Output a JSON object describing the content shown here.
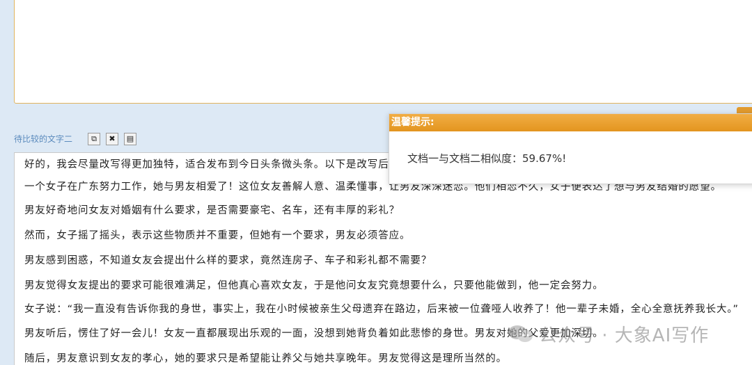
{
  "compare_field_label": "待比较的文字二",
  "toolbar": [
    {
      "name": "copy-icon",
      "glyph": "⧉"
    },
    {
      "name": "clear-icon",
      "glyph": "✖"
    },
    {
      "name": "comment-icon",
      "glyph": "▤"
    }
  ],
  "text_lines": [
    "好的，我会尽量改写得更加独特，适合发布到今日头条微头条。以下是改写后的内容：",
    "一个女子在广东努力工作，她与男友相爱了！这位女友善解人意、温柔懂事，让男友深深迷恋。他们相恋不久，女子便表达了想与男友结婚的愿望。",
    "男友好奇地问女友对婚姻有什么要求，是否需要豪宅、名车，还有丰厚的彩礼？",
    "然而，女子摇了摇头，表示这些物质并不重要，但她有一个要求，男友必须答应。",
    "男友感到困惑，不知道女友会提出什么样的要求，竟然连房子、车子和彩礼都不需要？",
    "男友觉得女友提出的要求可能很难满足，但他真心喜欢女友，于是他问女友究竟想要什么，只要他能做到，他一定会努力。",
    "女子说：“我一直没有告诉你我的身世，事实上，我在小时候被亲生父母遗弃在路边，后来被一位聋哑人收养了！他一辈子未婚，全心全意抚养我长大。”",
    "男友听后，愣住了好一会儿！女友一直都展现出乐观的一面，没想到她背负着如此悲惨的身世。男友对她的父爱更加深切。",
    "随后，男友意识到女友的孝心，她的要求只是希望能让养父与她共享晚年。男友觉得这是理所当然的。"
  ],
  "dialog": {
    "title": "温馨提示:",
    "message": "文档一与文档二相似度：59.67%!"
  },
  "watermark": {
    "text": "公众号 · 大象AI写作",
    "icon": "wechat-icon"
  },
  "colors": {
    "accent_orange": "#e3951f",
    "label_blue": "#5b8bbd",
    "background": "#dde9f5"
  }
}
